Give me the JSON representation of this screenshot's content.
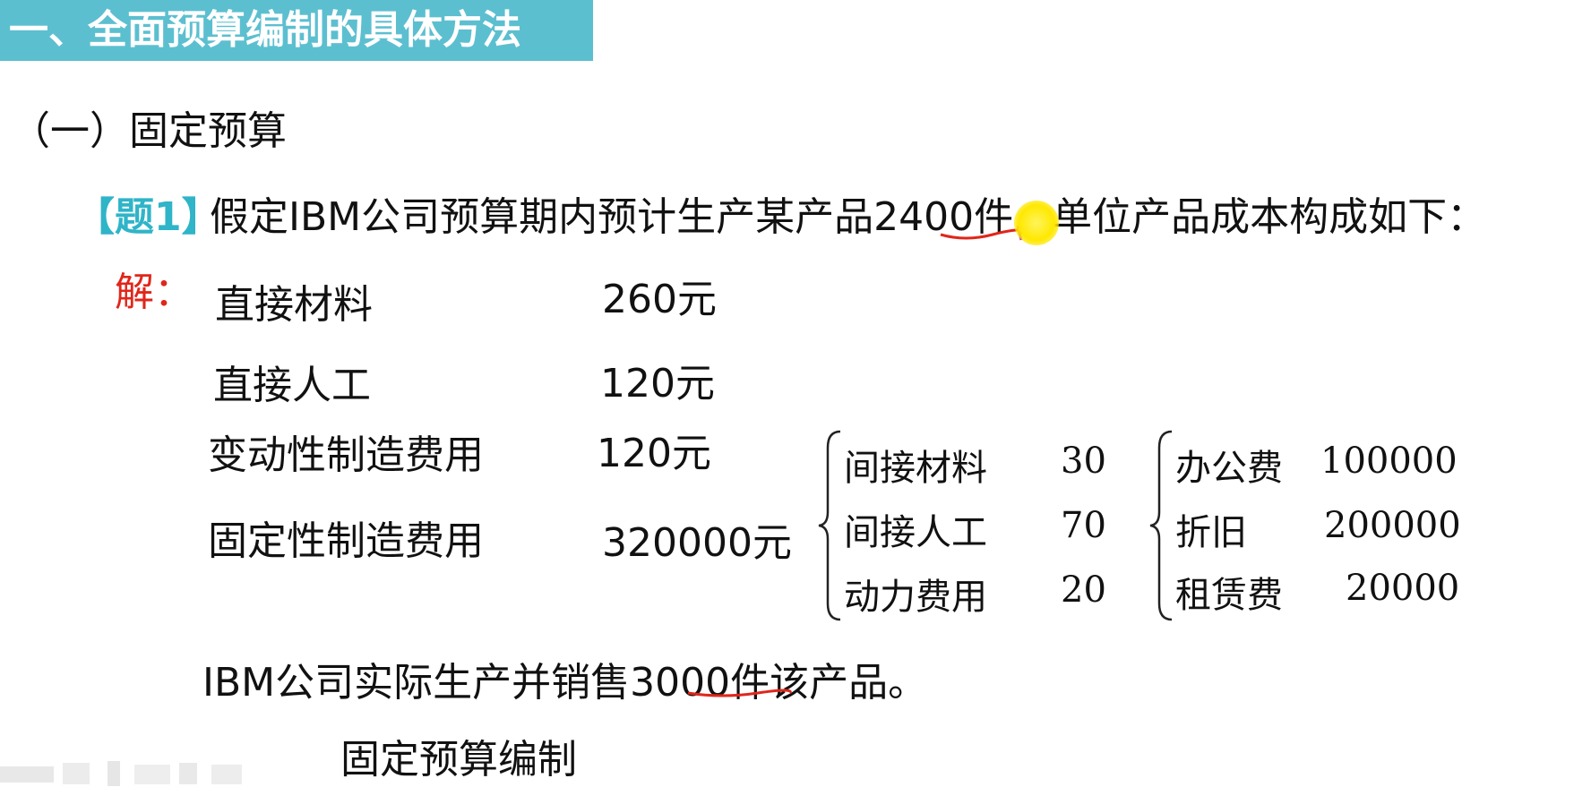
{
  "header": {
    "title": "一、全面预算编制的具体方法"
  },
  "section": {
    "title": "（一）固定预算"
  },
  "question": {
    "tag": "【题1】",
    "text_before": "假定IBM公司预算期内预计生产某产品",
    "quantity": "2400件",
    "text_after": "，单位产品成本构成如下："
  },
  "solution": {
    "label": "解：",
    "cost_rows": [
      {
        "label": "直接材料",
        "value": "260元"
      },
      {
        "label": "直接人工",
        "value": "120元"
      },
      {
        "label": "变动性制造费用",
        "value": "120元"
      },
      {
        "label": "固定性制造费用",
        "value": "320000元"
      }
    ],
    "variable_breakdown": [
      {
        "label": "间接材料",
        "value": "30"
      },
      {
        "label": "间接人工",
        "value": "70"
      },
      {
        "label": "动力费用",
        "value": "20"
      }
    ],
    "fixed_breakdown": [
      {
        "label": "办公费",
        "value": "100000"
      },
      {
        "label": "折旧",
        "value": "200000"
      },
      {
        "label": "租赁费",
        "value": "20000"
      }
    ]
  },
  "actual": {
    "text_before": "IBM公司实际生产并销售",
    "quantity": "3000件",
    "text_after": "该产品。"
  },
  "footer": {
    "subtitle": "固定预算编制"
  },
  "colors": {
    "banner": "#5cbfd0",
    "tag": "#2fb4c8",
    "solve": "#e0261a",
    "underline": "#e0261a",
    "pointer": "#ffe800"
  }
}
